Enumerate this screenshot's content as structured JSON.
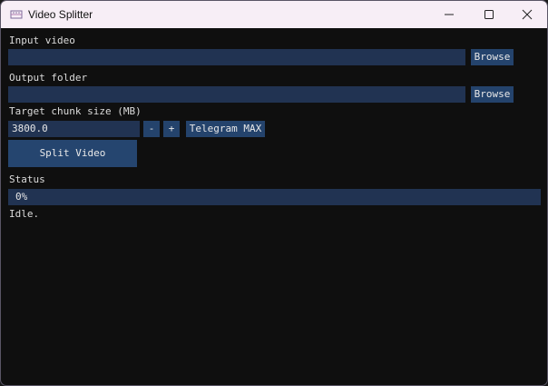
{
  "window": {
    "title": "Video Splitter",
    "controls": {
      "minimize_icon": "minimize-icon",
      "maximize_icon": "maximize-icon",
      "close_icon": "close-icon"
    }
  },
  "input_video": {
    "label": "Input video",
    "value": "",
    "browse_label": "Browse"
  },
  "output_folder": {
    "label": "Output folder",
    "value": "",
    "browse_label": "Browse"
  },
  "chunk_size": {
    "label": "Target chunk size (MB)",
    "value": "3800.0",
    "decrement_label": "-",
    "increment_label": "+",
    "preset_label": "Telegram MAX"
  },
  "split_button": {
    "label": "Split Video"
  },
  "status": {
    "label": "Status",
    "progress_percent": 0,
    "progress_text": "0%",
    "message": "Idle."
  },
  "colors": {
    "background": "#0f0f0f",
    "field": "#213352",
    "button": "#24436c",
    "titlebar": "#f7eef6",
    "text": "#dcdcdc"
  }
}
